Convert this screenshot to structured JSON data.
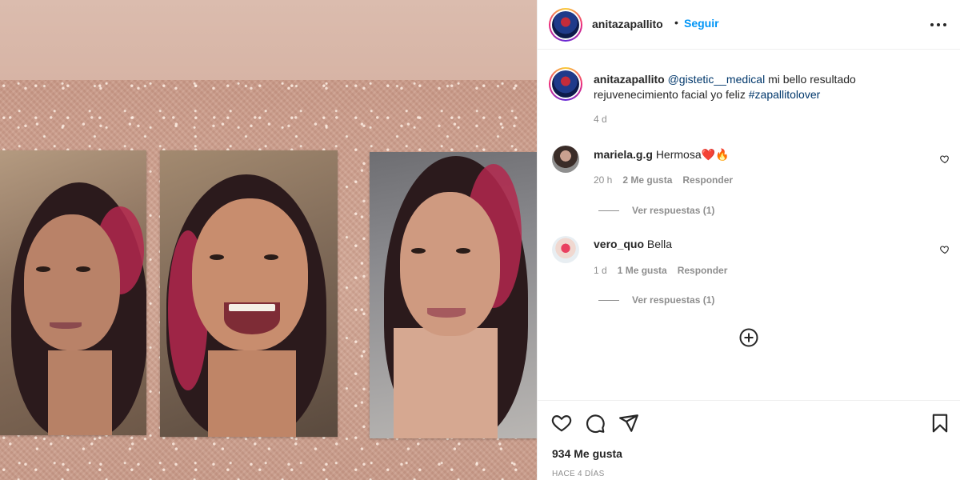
{
  "header": {
    "username": "anitazapallito",
    "separator": "•",
    "follow_label": "Seguir",
    "more_icon": "more-options-icon"
  },
  "caption": {
    "username": "anitazapallito",
    "mention": "@gistetic__medical",
    "text_before_hashtag": " mi bello resultado rejuvenecimiento facial yo feliz ",
    "hashtag": "#zapallitolover",
    "age": "4 d"
  },
  "comments": [
    {
      "username": "mariela.g.g",
      "text": "Hermosa❤️🔥",
      "age": "20 h",
      "likes": "2 Me gusta",
      "reply_label": "Responder",
      "view_replies": "Ver respuestas (1)"
    },
    {
      "username": "vero_quo",
      "text": "Bella",
      "age": "1 d",
      "likes": "1 Me gusta",
      "reply_label": "Responder",
      "view_replies": "Ver respuestas (1)"
    }
  ],
  "actions": {
    "likes_count": "934 Me gusta",
    "date": "HACE 4 DÍAS"
  },
  "colors": {
    "link": "#0095f6",
    "mention": "#00376b",
    "secondary_text": "#8e8e8e",
    "primary_text": "#262626"
  }
}
